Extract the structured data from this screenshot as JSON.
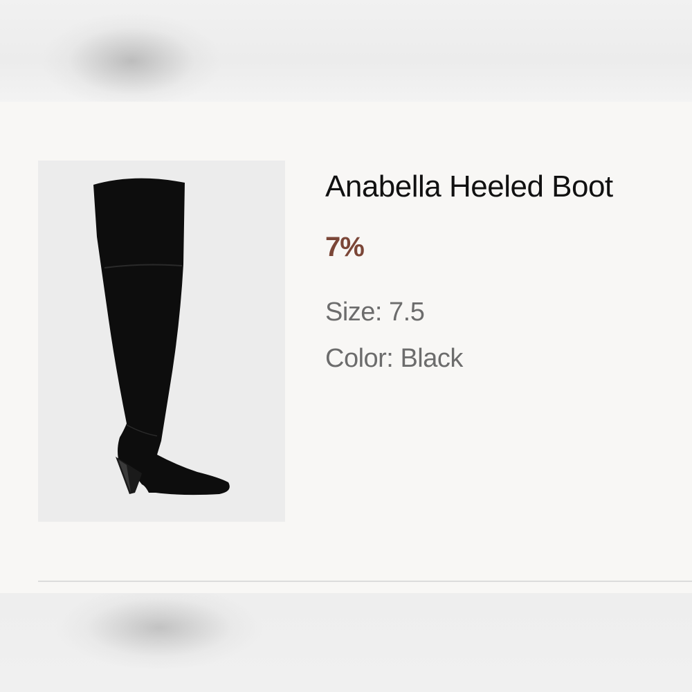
{
  "product": {
    "title": "Anabella Heeled Boot",
    "discount": "7%",
    "size_label": "Size:",
    "size_value": "7.5",
    "color_label": "Color:",
    "color_value": "Black",
    "image_icon": "boot-image"
  },
  "colors": {
    "page_background": "#f8f7f5",
    "image_background": "#ececec",
    "title_text": "#111111",
    "discount_text": "#7b4637",
    "meta_text": "#6c6c6c",
    "divider": "#dcdcdc"
  }
}
